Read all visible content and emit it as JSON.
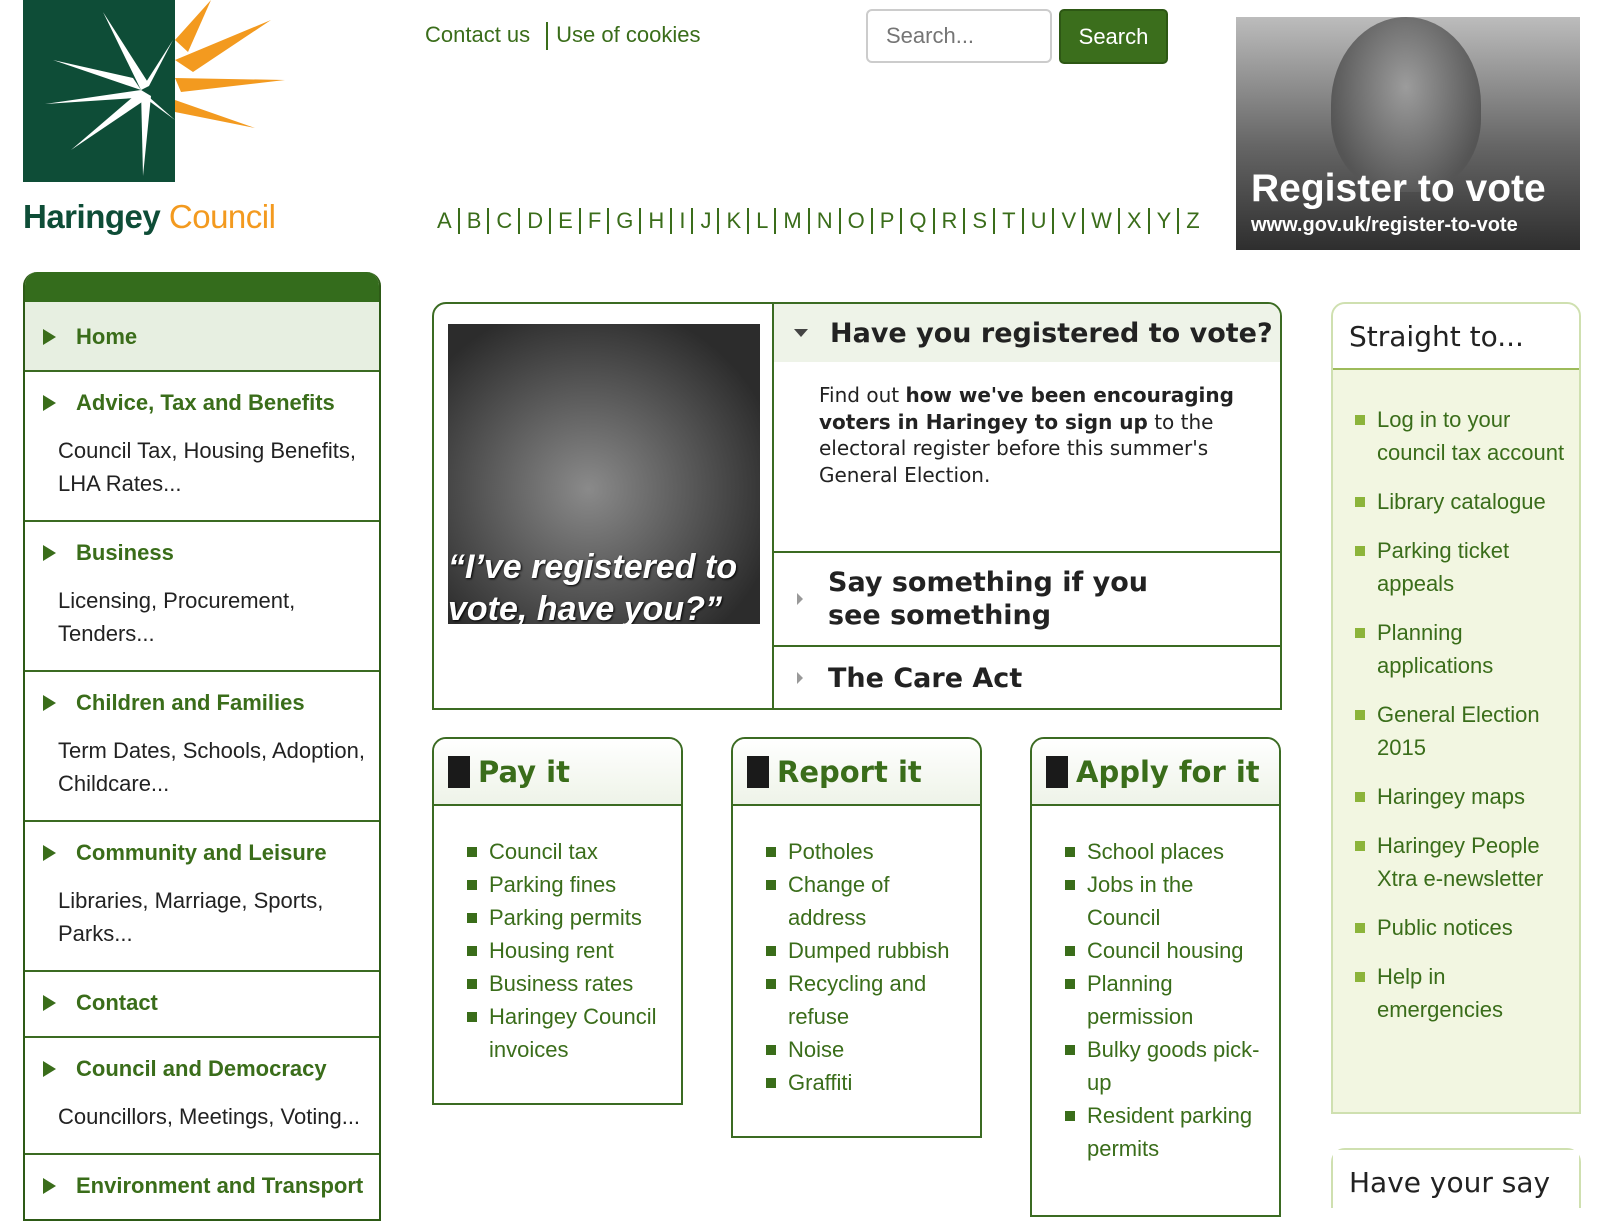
{
  "logo": {
    "name": "Haringey",
    "suffix": "Council"
  },
  "header": {
    "links": [
      "Contact us",
      "Use of cookies"
    ],
    "search": {
      "placeholder": "Search...",
      "button": "Search"
    },
    "promo": {
      "title": "Register to vote",
      "url": "www.gov.uk/register-to-vote"
    },
    "alphabet": [
      "A",
      "B",
      "C",
      "D",
      "E",
      "F",
      "G",
      "H",
      "I",
      "J",
      "K",
      "L",
      "M",
      "N",
      "O",
      "P",
      "Q",
      "R",
      "S",
      "T",
      "U",
      "V",
      "W",
      "X",
      "Y",
      "Z"
    ]
  },
  "nav": {
    "items": [
      {
        "title": "Home",
        "sub": ""
      },
      {
        "title": "Advice, Tax and Benefits",
        "sub": "Council Tax, Housing Benefits, LHA Rates..."
      },
      {
        "title": "Business",
        "sub": "Licensing, Procurement, Tenders..."
      },
      {
        "title": "Children and Families",
        "sub": "Term Dates, Schools, Adoption, Childcare..."
      },
      {
        "title": "Community and Leisure",
        "sub": "Libraries, Marriage, Sports, Parks..."
      },
      {
        "title": "Contact",
        "sub": ""
      },
      {
        "title": "Council and Democracy",
        "sub": "Councillors, Meetings, Voting..."
      },
      {
        "title": "Environment and Transport",
        "sub": ""
      }
    ]
  },
  "feature": {
    "image_caption": "“I’ve registered to vote, have you?”",
    "accordion": {
      "open_title": "Have you registered to vote?",
      "body_pre": "Find out ",
      "body_bold": "how we've been encouraging voters in Haringey to sign up",
      "body_post": " to the electoral register before this summer's General Election.",
      "closed": [
        "Say something if you see something",
        "The Care Act"
      ]
    }
  },
  "actions": [
    {
      "title": "Pay it",
      "icon": "pay-icon",
      "items": [
        "Council tax",
        "Parking fines",
        "Parking permits",
        "Housing rent",
        "Business rates",
        "Haringey Council invoices"
      ]
    },
    {
      "title": "Report it",
      "icon": "report-icon",
      "items": [
        "Potholes",
        "Change of address",
        "Dumped rubbish",
        "Recycling and refuse",
        "Noise",
        "Graffiti"
      ]
    },
    {
      "title": "Apply for it",
      "icon": "apply-icon",
      "items": [
        "School places",
        "Jobs in the Council",
        "Council housing",
        "Planning permission",
        "Bulky goods pick-up",
        "Resident parking permits"
      ]
    }
  ],
  "straight_to": {
    "title": "Straight to...",
    "items": [
      "Log in to your council tax account",
      "Library catalogue",
      "Parking ticket appeals",
      "Planning applications",
      "General Election 2015",
      "Haringey maps",
      "Haringey People Xtra e-newsletter",
      "Public notices",
      "Help in emergencies"
    ]
  },
  "have_your_say": {
    "title": "Have your say"
  }
}
